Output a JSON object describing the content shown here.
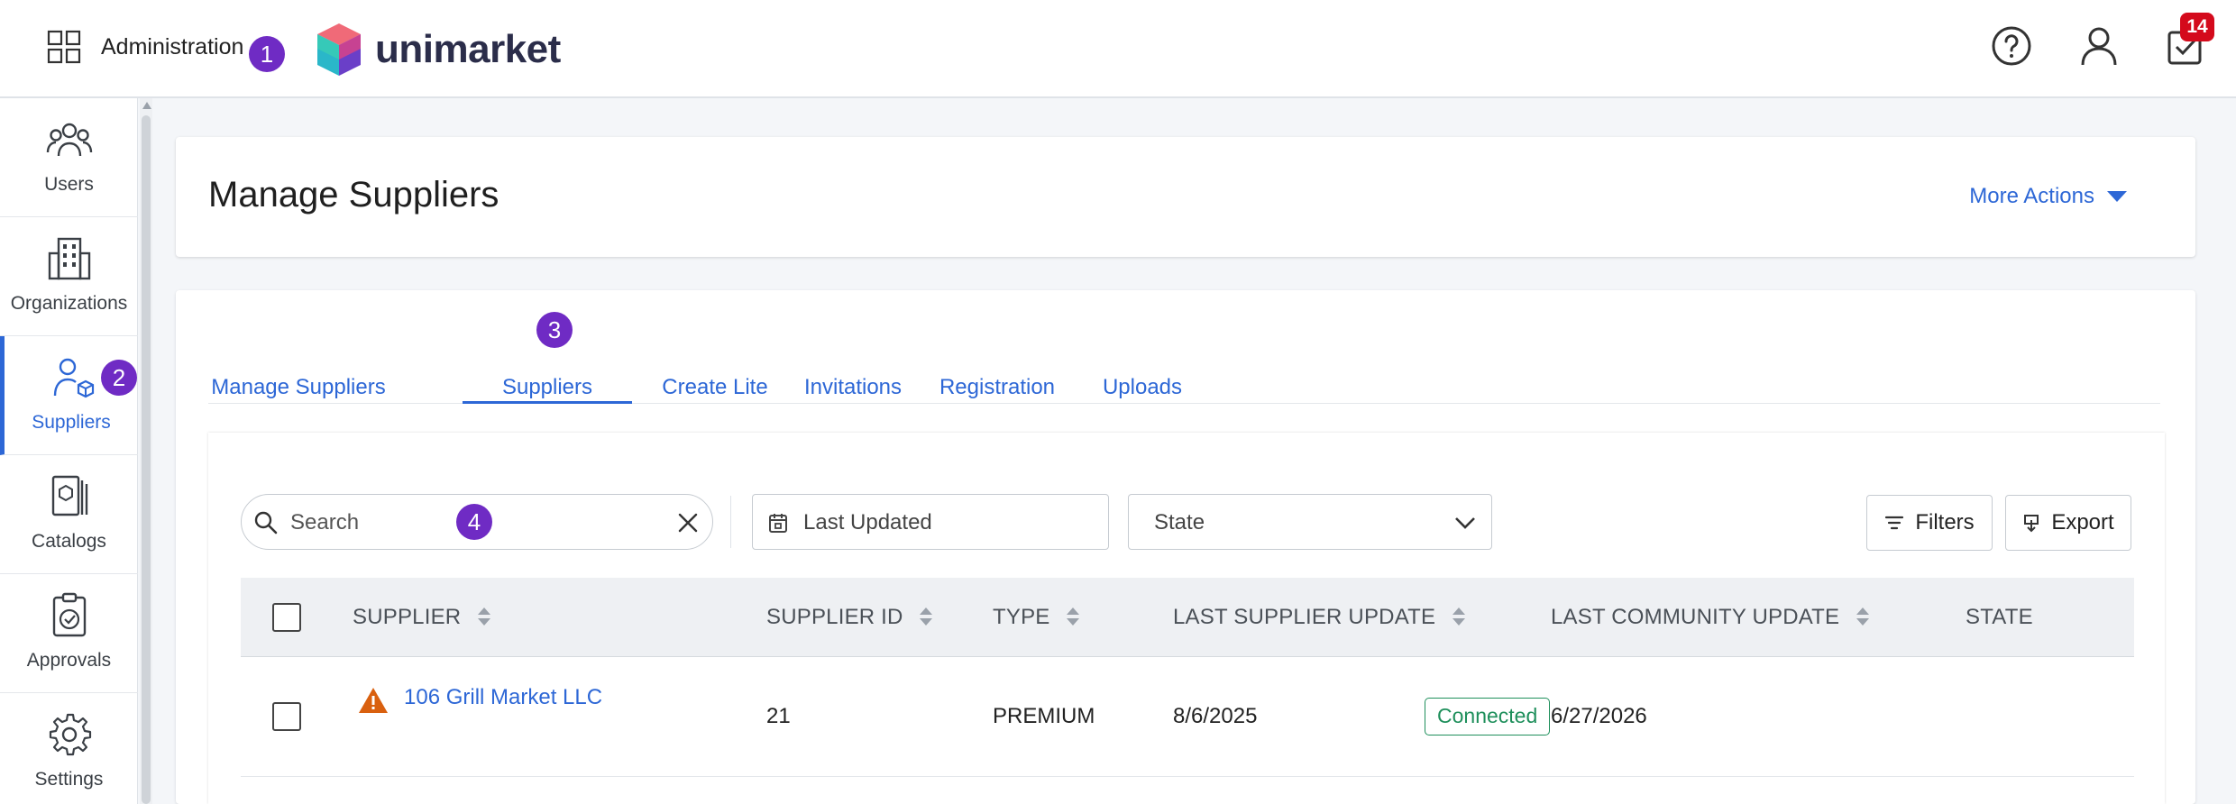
{
  "topbar": {
    "admin_label": "Administration",
    "badge_1": "1",
    "logo_text": "unimarket",
    "notification_count": "14"
  },
  "sidebar": {
    "items": [
      {
        "label": "Users",
        "icon": "users-icon"
      },
      {
        "label": "Organizations",
        "icon": "building-icon"
      },
      {
        "label": "Suppliers",
        "icon": "supplier-icon",
        "active": true
      },
      {
        "label": "Catalogs",
        "icon": "catalog-icon"
      },
      {
        "label": "Approvals",
        "icon": "approval-icon"
      },
      {
        "label": "Settings",
        "icon": "gear-icon"
      }
    ],
    "badge_2": "2"
  },
  "header": {
    "title": "Manage Suppliers",
    "more_actions": "More Actions"
  },
  "tabs": {
    "items": [
      {
        "label": "Manage Suppliers"
      },
      {
        "label": "Suppliers",
        "active": true
      },
      {
        "label": "Create Lite"
      },
      {
        "label": "Invitations"
      },
      {
        "label": "Registration"
      },
      {
        "label": "Uploads"
      }
    ],
    "badge_3": "3"
  },
  "filters": {
    "search_placeholder": "Search",
    "badge_4": "4",
    "date_label": "Last Updated",
    "state_label": "State",
    "filters_button": "Filters",
    "export_button": "Export"
  },
  "table": {
    "columns": [
      "SUPPLIER",
      "SUPPLIER ID",
      "TYPE",
      "LAST SUPPLIER UPDATE",
      "LAST COMMUNITY UPDATE",
      "STATE"
    ],
    "rows": [
      {
        "supplier": "106 Grill Market LLC",
        "supplier_id": "21",
        "type": "PREMIUM",
        "last_supplier_update": "8/6/2025",
        "last_community_update": "6/27/2026",
        "state": "Connected"
      }
    ]
  },
  "colors": {
    "accent": "#2d67d6",
    "badge": "#6f2bc4",
    "notification": "#d40a1c",
    "connected": "#1e8f5b",
    "warning": "#d9600f"
  }
}
